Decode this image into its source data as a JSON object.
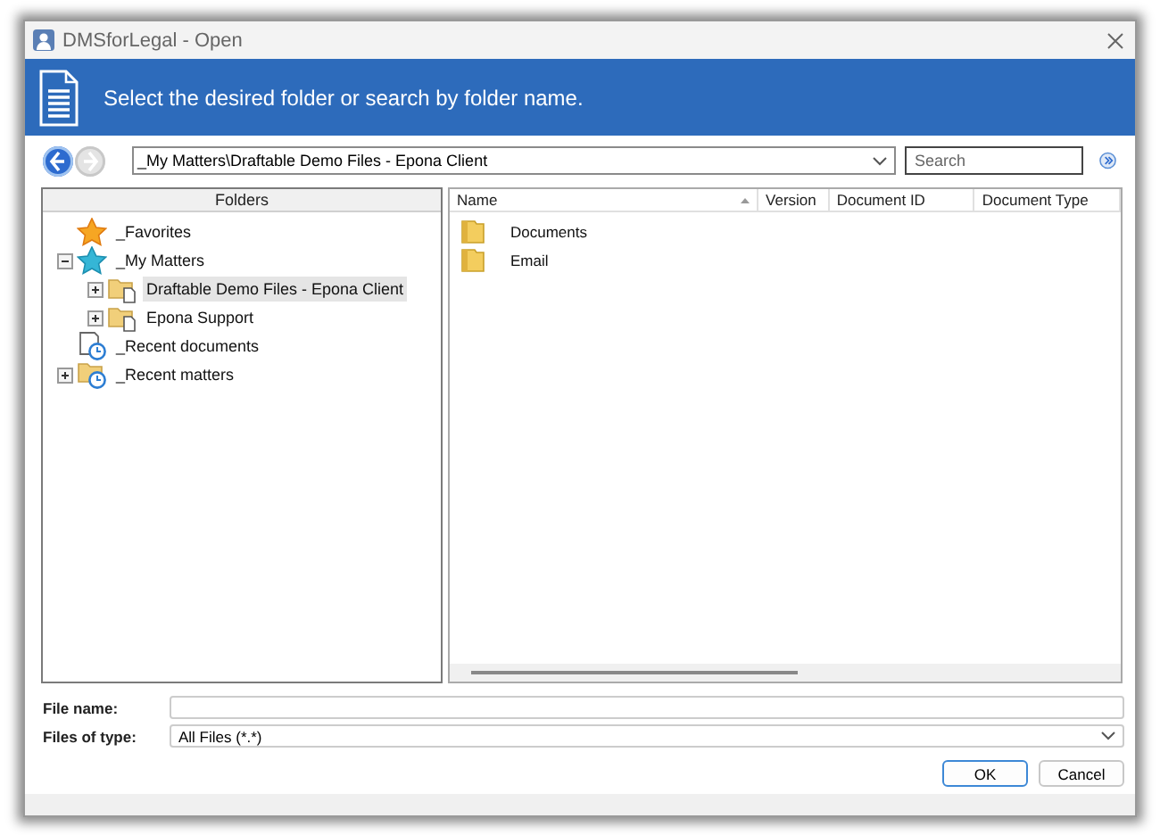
{
  "window": {
    "title": "DMSforLegal - Open"
  },
  "banner": {
    "text": "Select the desired folder or search by folder name."
  },
  "navigation": {
    "buttons": [
      {
        "kind": "back",
        "disabled": false
      },
      {
        "kind": "forward",
        "disabled": true
      }
    ],
    "path": "_My Matters\\Draftable Demo Files - Epona Client",
    "search": {
      "placeholder": "Search"
    }
  },
  "folders_panel": {
    "title": "Folders",
    "tree": [
      {
        "label": "_Favorites",
        "kind": "favorites",
        "selected": false
      },
      {
        "label": "_My Matters",
        "kind": "matters",
        "expanded": true,
        "selected": false,
        "children": [
          {
            "label": "Draftable Demo Files - Epona Client",
            "kind": "matter-folder",
            "expanded": false,
            "selected": true
          },
          {
            "label": "Epona Support",
            "kind": "matter-folder",
            "expanded": false,
            "selected": false
          }
        ]
      },
      {
        "label": "_Recent documents",
        "kind": "recent-documents",
        "selected": false
      },
      {
        "label": "_Recent matters",
        "kind": "recent-matters",
        "expanded": false,
        "selected": false
      }
    ]
  },
  "file_list": {
    "columns": [
      {
        "label": "Name",
        "sorted": true
      },
      {
        "label": "Version",
        "sorted": false
      },
      {
        "label": "Document ID",
        "sorted": false
      },
      {
        "label": "Document Type",
        "sorted": false
      }
    ],
    "rows": [
      {
        "name": "Documents",
        "kind": "folder"
      },
      {
        "name": "Email",
        "kind": "folder"
      }
    ]
  },
  "file_name": {
    "label": "File name:"
  },
  "file_type": {
    "label": "Files of type:",
    "value": "All Files (*.*)"
  },
  "buttons": [
    {
      "label": "OK",
      "default": true
    },
    {
      "label": "Cancel",
      "default": false
    }
  ]
}
